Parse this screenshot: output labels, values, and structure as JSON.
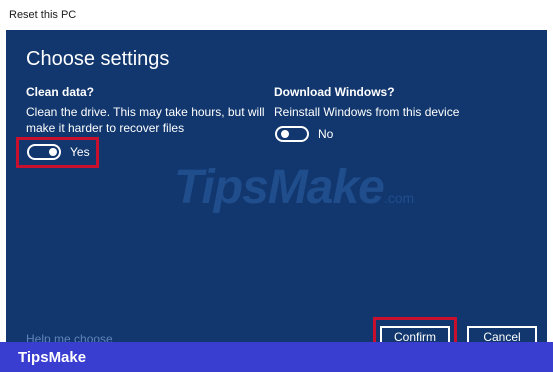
{
  "window": {
    "title": "Reset this PC"
  },
  "dialog": {
    "heading": "Choose settings",
    "clean_data": {
      "title": "Clean data?",
      "description_line1": "Clean the drive. This may take hours, but will",
      "description_line2": "make it harder to recover files",
      "toggle_label": "Yes",
      "toggle_on": true
    },
    "download_windows": {
      "title": "Download Windows?",
      "description": "Reinstall Windows from this device",
      "toggle_label": "No",
      "toggle_on": false
    },
    "help_link": "Help me choose",
    "confirm_label": "Confirm",
    "cancel_label": "Cancel"
  },
  "watermark": {
    "main": "TipsMake",
    "suffix": ".com"
  },
  "footer": {
    "brand": "TipsMake"
  },
  "colors": {
    "dialog_bg": "#11376e",
    "highlight": "#c8102e",
    "footer_bg": "#3a3ed0"
  }
}
